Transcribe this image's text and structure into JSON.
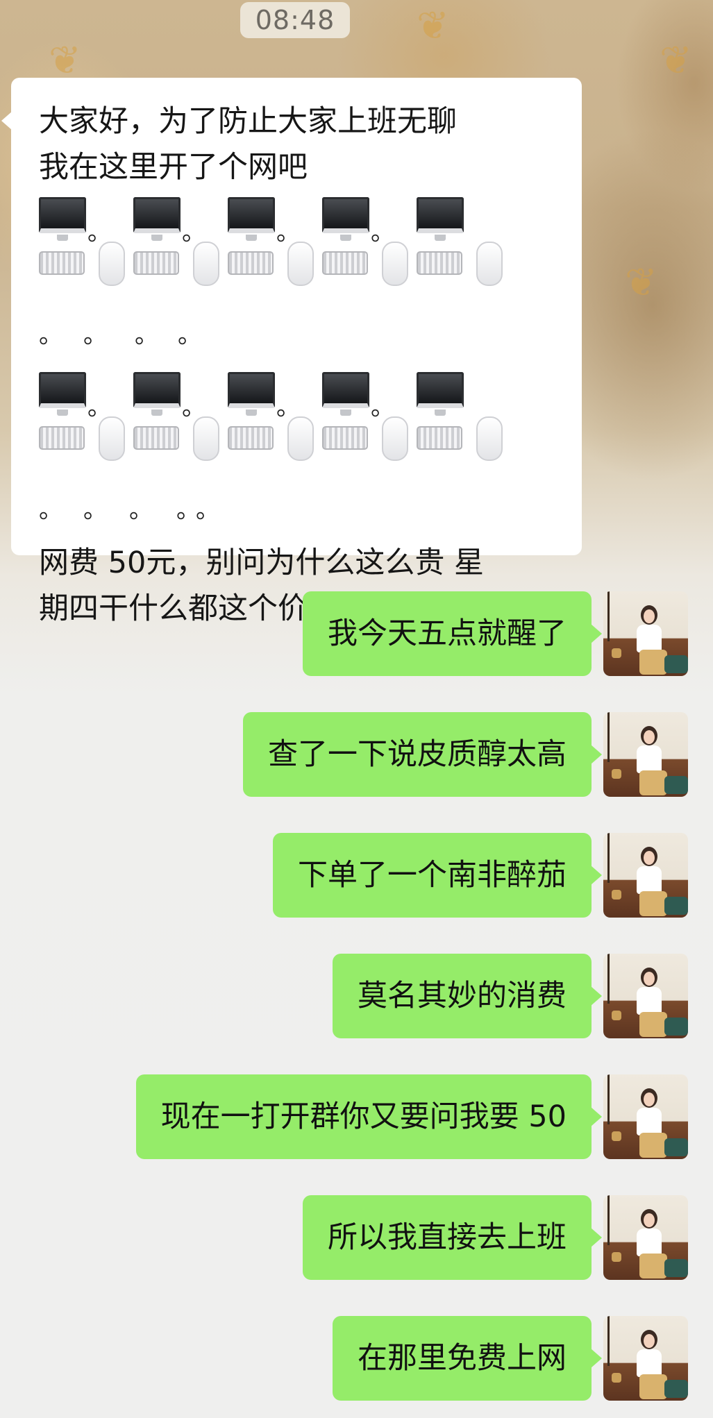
{
  "status": {
    "time": "08:48"
  },
  "incoming_message": {
    "line1": "大家好，为了防止大家上班无聊",
    "line2": "我在这里开了个网吧",
    "line3": "网费 50元，别问为什么这么贵 星",
    "line4": "期四干什么都这个价",
    "device_rows": [
      [
        "computer-icon",
        "keyboard-icon",
        "mouse-icon"
      ],
      [
        "computer-icon",
        "keyboard-icon",
        "mouse-icon"
      ]
    ],
    "dot_char": "。"
  },
  "outgoing_messages": [
    {
      "text": "我今天五点就醒了"
    },
    {
      "text": "查了一下说皮质醇太高"
    },
    {
      "text": "下单了一个南非醉茄"
    },
    {
      "text": "莫名其妙的消费"
    },
    {
      "text": "现在一打开群你又要问我要 50"
    },
    {
      "text": "所以我直接去上班"
    },
    {
      "text": "在那里免费上网"
    }
  ],
  "colors": {
    "outgoing_bubble": "#95ec69",
    "incoming_bubble": "#ffffff",
    "time_text": "#6e6a63"
  }
}
